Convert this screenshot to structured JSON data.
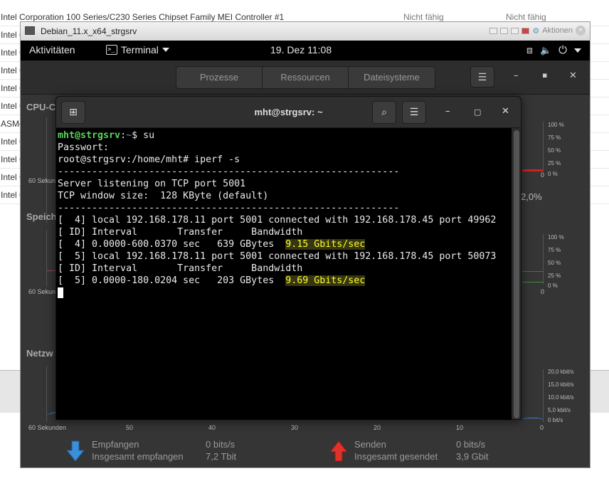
{
  "bg_rows": [
    {
      "c1": "Intel Corporation 100 Series/C230 Series Chipset Family MEI Controller #1",
      "c2": "Nicht fähig",
      "c3": "Nicht fähig"
    },
    {
      "c1": "Intel C"
    },
    {
      "c1": "Intel C"
    },
    {
      "c1": "Intel C"
    },
    {
      "c1": "Intel C"
    },
    {
      "c1": "Intel C"
    },
    {
      "c1": "ASMe"
    },
    {
      "c1": "Intel C"
    },
    {
      "c1": "Intel C"
    },
    {
      "c1": "Intel C"
    },
    {
      "c1": "Intel C"
    }
  ],
  "vbox": {
    "title": "Debian_11.x_x64_strgsrv",
    "actions": "Aktionen"
  },
  "gnome": {
    "activities": "Aktivitäten",
    "app": "Terminal",
    "clock": "19. Dez  11:08"
  },
  "sysmon": {
    "tabs": [
      "Prozesse",
      "Ressourcen",
      "Dateisysteme"
    ],
    "cpu_label": "CPU-C",
    "mem_label": "Speich",
    "net_label": "Netzw",
    "pct_labels": [
      "100 %",
      "75 %",
      "50 %",
      "25 %",
      "0 %"
    ],
    "net_labels": [
      "20,0 kbit/s",
      "15,0 kbit/s",
      "10,0 kbit/s",
      "5,0 kbit/s",
      "0 bit/s"
    ],
    "cpu_value": "2,0%",
    "time_axis": [
      "60 Sekunden",
      "50",
      "40",
      "30",
      "20",
      "10",
      "0"
    ],
    "sekunden_short": "60 Sekun",
    "recv_label": "Empfangen",
    "recv_rate": "0 bits/s",
    "recv_total_label": "Insgesamt empfangen",
    "recv_total": "7,2 Tbit",
    "send_label": "Senden",
    "send_rate": "0 bits/s",
    "send_total_label": "Insgesamt gesendet",
    "send_total": "3,9 Gbit",
    "colors": {
      "recv": "#3b8fd9",
      "send": "#e0322b"
    }
  },
  "terminal": {
    "title": "mht@strgsrv: ~",
    "user": "mht@strgsrv",
    "path": "~",
    "cmd1": "$ su",
    "lines": [
      "Passwort:",
      "root@strgsrv:/home/mht# iperf -s",
      "------------------------------------------------------------",
      "Server listening on TCP port 5001",
      "TCP window size:  128 KByte (default)",
      "------------------------------------------------------------",
      "[  4] local 192.168.178.11 port 5001 connected with 192.168.178.45 port 49962",
      "[ ID] Interval       Transfer     Bandwidth"
    ],
    "r1_pre": "[  4] 0.0000-600.0370 sec   639 GBytes  ",
    "r1_bw": "9.15 Gbits/sec",
    "lines2": [
      "[  5] local 192.168.178.11 port 5001 connected with 192.168.178.45 port 50073",
      "[ ID] Interval       Transfer     Bandwidth"
    ],
    "r2_pre": "[  5] 0.0000-180.0204 sec   203 GBytes  ",
    "r2_bw": "9.69 Gbits/sec"
  }
}
